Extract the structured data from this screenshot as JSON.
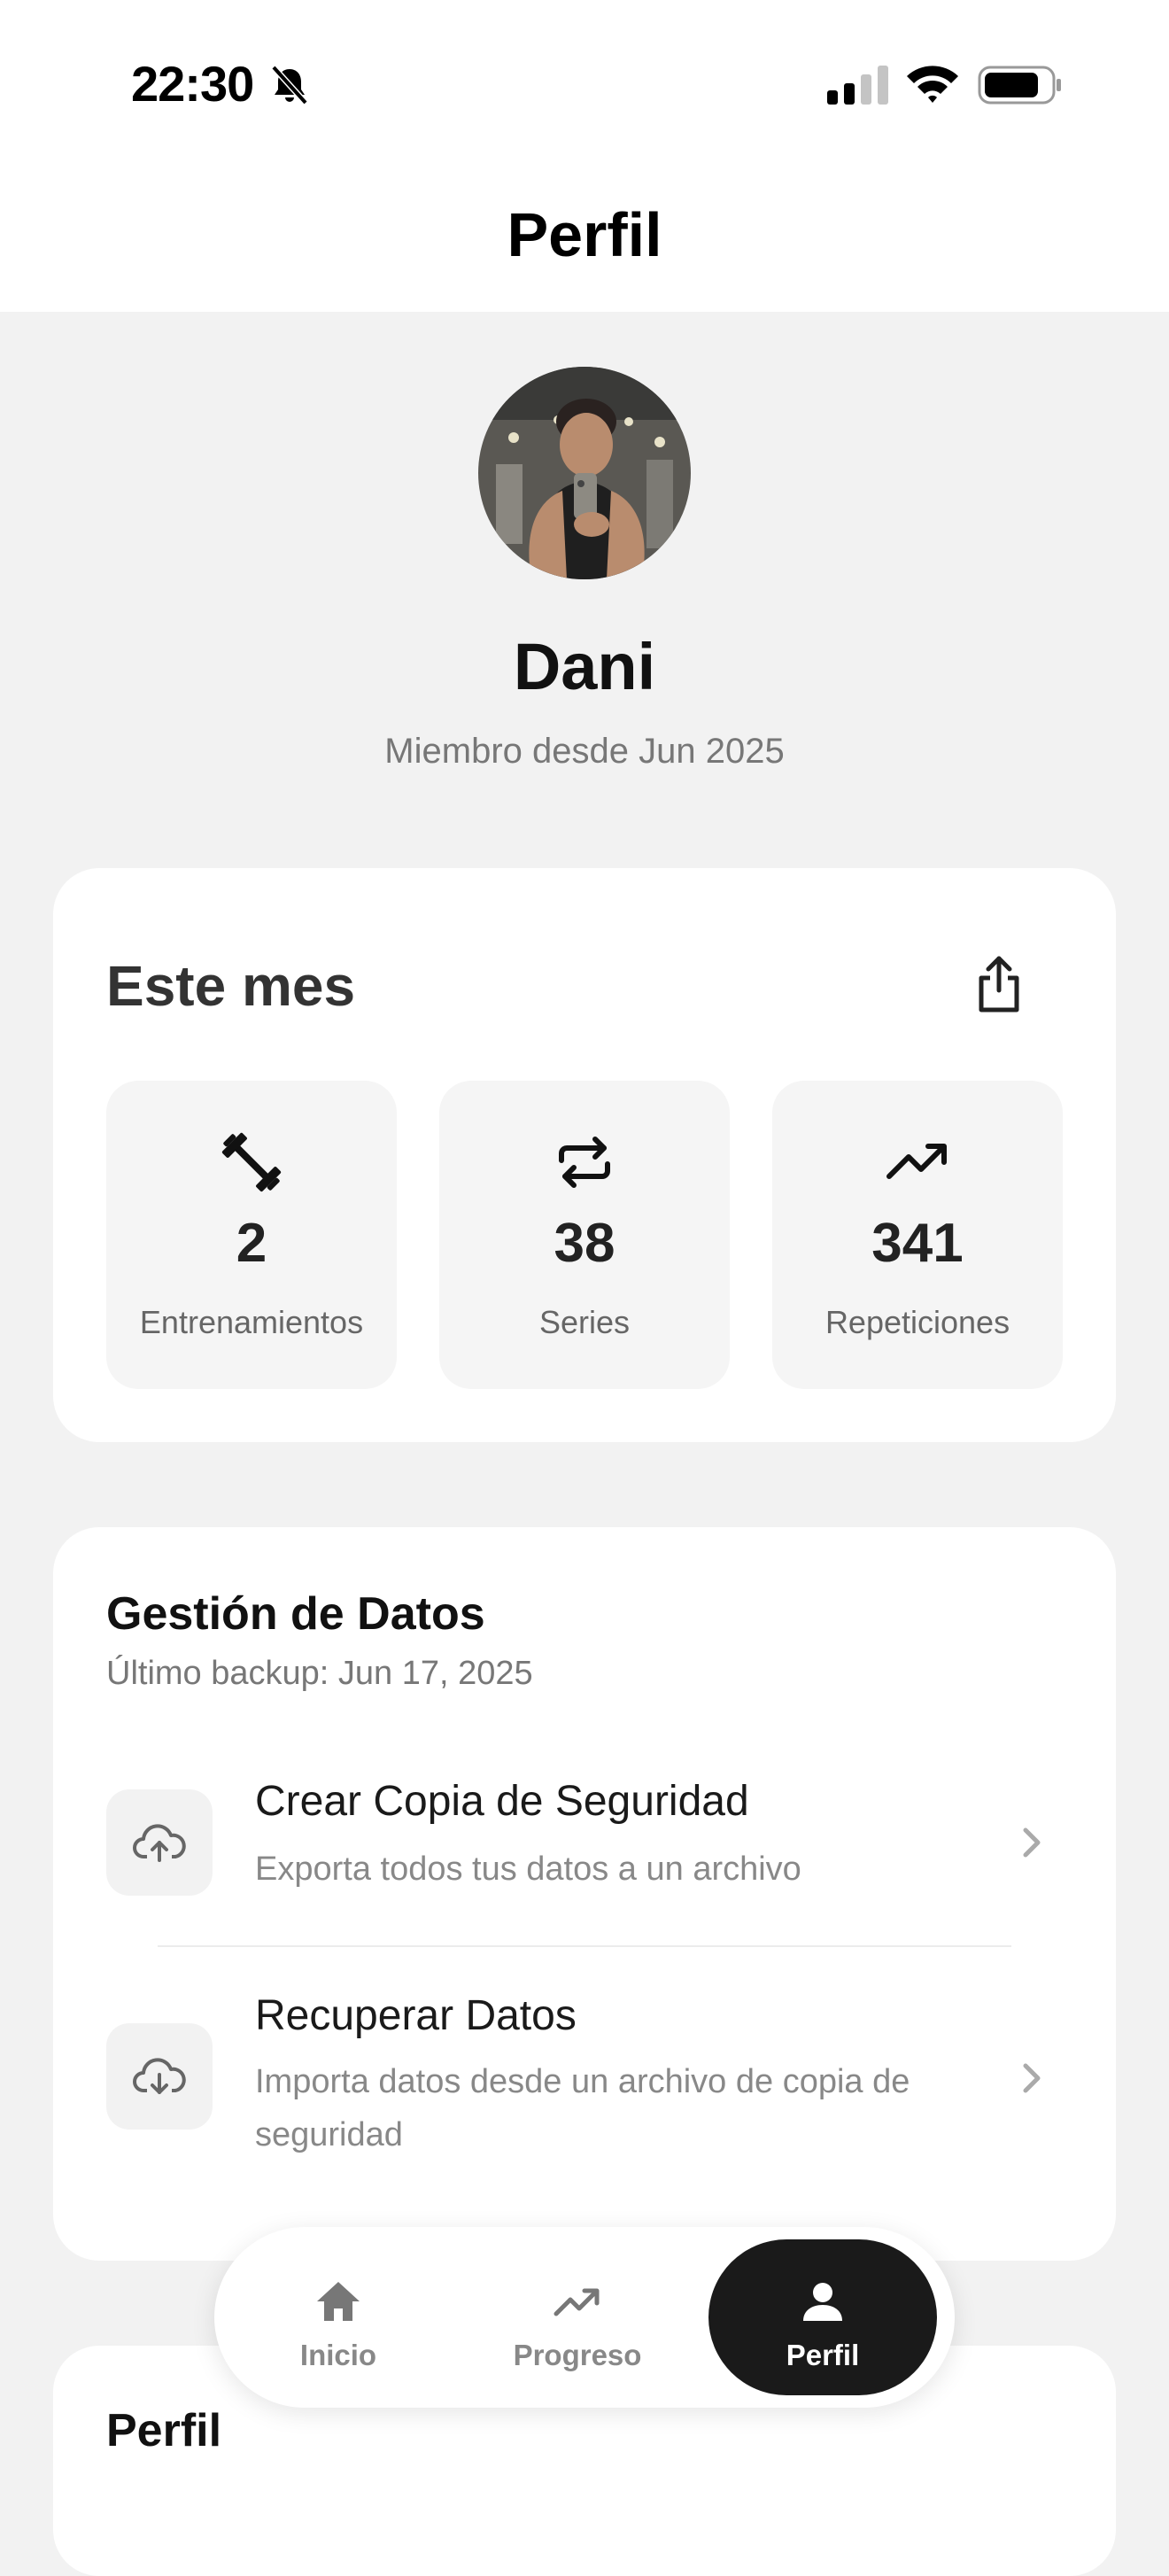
{
  "status_bar": {
    "time": "22:30"
  },
  "header": {
    "title": "Perfil"
  },
  "profile": {
    "name": "Dani",
    "member_since": "Miembro desde Jun 2025"
  },
  "this_month": {
    "title": "Este mes",
    "stats": [
      {
        "icon": "dumbbell-icon",
        "value": "2",
        "label": "Entrenamientos"
      },
      {
        "icon": "repeat-icon",
        "value": "38",
        "label": "Series"
      },
      {
        "icon": "trending-up-icon",
        "value": "341",
        "label": "Repeticiones"
      }
    ]
  },
  "data_management": {
    "title": "Gestión de Datos",
    "last_backup": "Último backup: Jun 17, 2025",
    "items": [
      {
        "icon": "cloud-upload-icon",
        "title": "Crear Copia de Seguridad",
        "description": "Exporta todos tus datos a un archivo"
      },
      {
        "icon": "cloud-download-icon",
        "title": "Recuperar Datos",
        "description": "Importa datos desde un archivo de copia de seguridad"
      }
    ]
  },
  "profile_section": {
    "title": "Perfil"
  },
  "tab_bar": {
    "tabs": [
      {
        "icon": "home-icon",
        "label": "Inicio",
        "active": false
      },
      {
        "icon": "trending-up-icon",
        "label": "Progreso",
        "active": false
      },
      {
        "icon": "person-icon",
        "label": "Perfil",
        "active": true
      }
    ]
  }
}
